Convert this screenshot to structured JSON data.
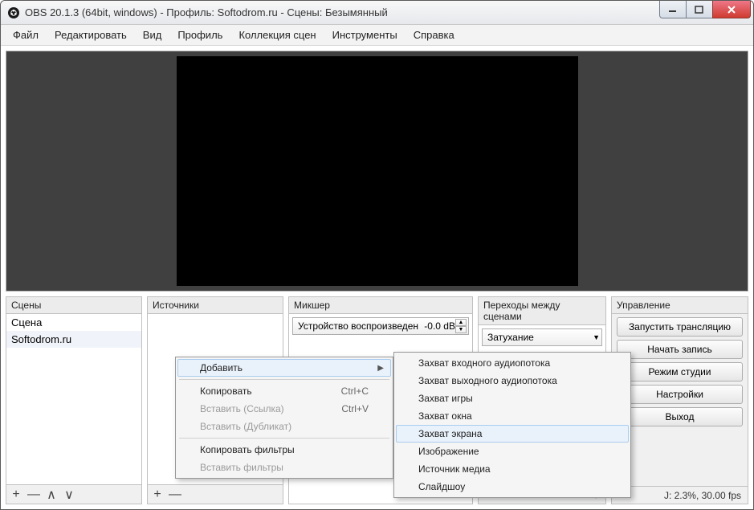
{
  "title": "OBS 20.1.3 (64bit, windows) - Профиль: Softodrom.ru - Сцены: Безымянный",
  "menubar": [
    "Файл",
    "Редактировать",
    "Вид",
    "Профиль",
    "Коллекция сцен",
    "Инструменты",
    "Справка"
  ],
  "panels": {
    "scenes": {
      "title": "Сцены",
      "items": [
        "Сцена",
        "Softodrom.ru"
      ]
    },
    "sources": {
      "title": "Источники"
    },
    "mixer": {
      "title": "Микшер",
      "device_label": "Устройство воспроизведен",
      "db": "-0.0 dB"
    },
    "transitions": {
      "title": "Переходы между сценами",
      "selected": "Затухание"
    },
    "controls": {
      "title": "Управление",
      "buttons": [
        "Запустить трансляцию",
        "Начать запись",
        "Режим студии",
        "Настройки",
        "Выход"
      ]
    }
  },
  "toolbtns": {
    "plus": "+",
    "minus": "—",
    "up": "∧",
    "down": "∨"
  },
  "status": "J: 2.3%, 30.00 fps",
  "context_menu1": {
    "add": "Добавить",
    "copy": {
      "label": "Копировать",
      "shortcut": "Ctrl+C"
    },
    "paste_ref": {
      "label": "Вставить (Ссылка)",
      "shortcut": "Ctrl+V"
    },
    "paste_dup": "Вставить (Дубликат)",
    "copy_filters": "Копировать фильтры",
    "paste_filters": "Вставить фильтры"
  },
  "context_menu2": [
    "Захват входного аудиопотока",
    "Захват выходного аудиопотока",
    "Захват игры",
    "Захват окна",
    "Захват экрана",
    "Изображение",
    "Источник медиа",
    "Слайдшоу"
  ],
  "icons": {
    "gear": "⚙",
    "dropdown": "▼",
    "sub": "▶",
    "spinup": "▲",
    "spindown": "▼"
  }
}
